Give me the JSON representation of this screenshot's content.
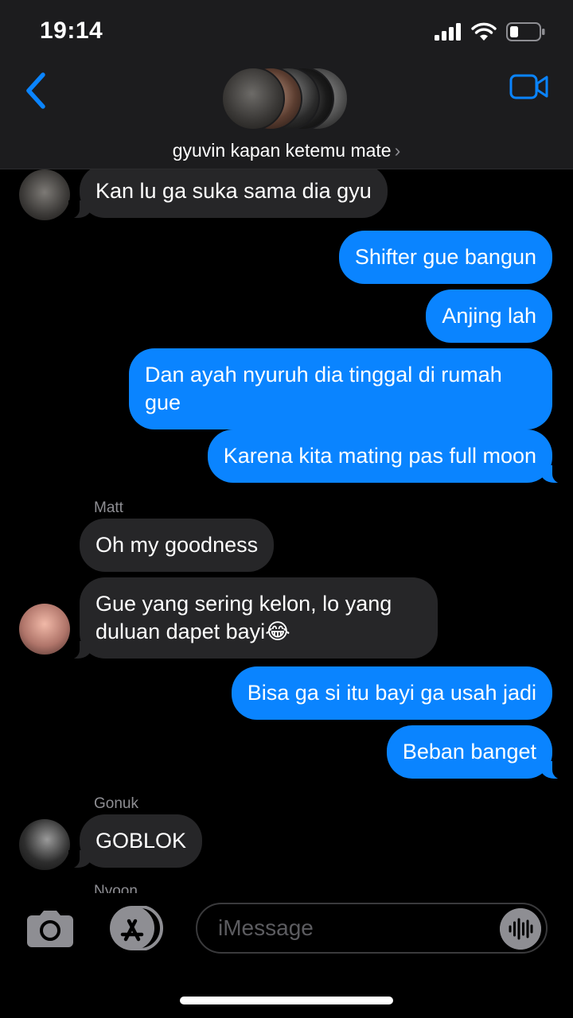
{
  "status": {
    "time": "19:14"
  },
  "header": {
    "group_name": "gyuvin kapan ketemu mate"
  },
  "messages": [
    {
      "dir": "in",
      "text": "Kan lu ga suka sama dia gyu"
    },
    {
      "dir": "out",
      "text": "Shifter gue bangun"
    },
    {
      "dir": "out",
      "text": "Anjing lah"
    },
    {
      "dir": "out",
      "text": "Dan ayah nyuruh dia tinggal di rumah gue"
    },
    {
      "dir": "out",
      "text": "Karena kita mating pas full moon"
    },
    {
      "dir": "in",
      "sender": "Matt",
      "text": "Oh my goodness"
    },
    {
      "dir": "in",
      "text": "Gue yang sering kelon, lo yang duluan dapet bayi😂"
    },
    {
      "dir": "out",
      "text": "Bisa ga si itu bayi ga usah jadi"
    },
    {
      "dir": "out",
      "text": "Beban banget"
    },
    {
      "dir": "in",
      "sender": "Gonuk",
      "text": "GOBLOK"
    },
    {
      "dir": "in",
      "sender": "Nyoon",
      "text": ""
    }
  ],
  "input": {
    "placeholder": "iMessage"
  },
  "icons": {
    "back": "chevron-left-icon",
    "video": "video-camera-icon",
    "camera": "camera-icon",
    "apps": "app-store-icon",
    "audio": "audio-waveform-icon"
  },
  "colors": {
    "accent": "#0a84ff",
    "incoming_bubble": "#262628",
    "header_bg": "#1c1c1e"
  }
}
